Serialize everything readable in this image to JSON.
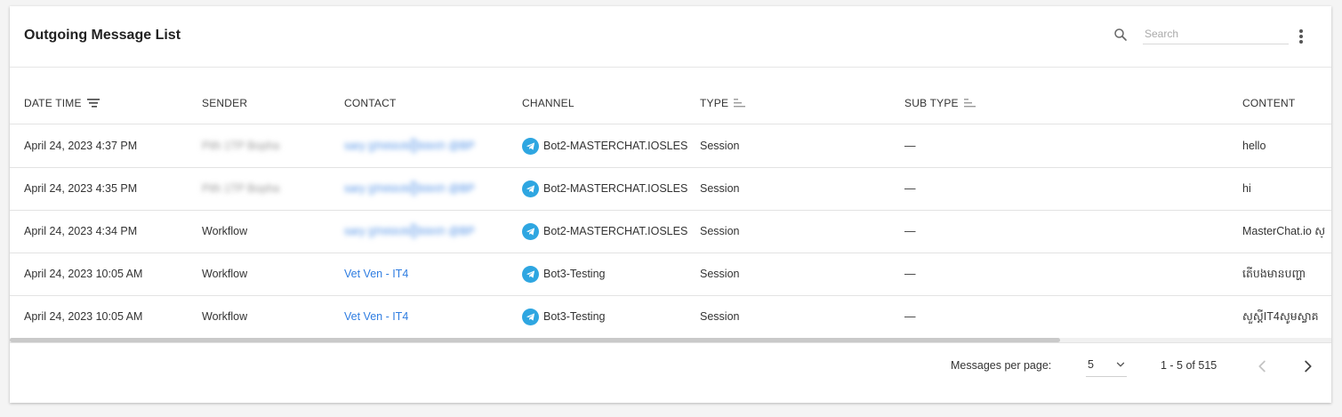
{
  "header": {
    "title": "Outgoing Message List",
    "search_placeholder": "Search"
  },
  "columns": [
    {
      "label": "DATE TIME",
      "icon": "sort-icon"
    },
    {
      "label": "SENDER"
    },
    {
      "label": "CONTACT"
    },
    {
      "label": "CHANNEL"
    },
    {
      "label": "TYPE",
      "icon": "sort-icon"
    },
    {
      "label": "SUB TYPE",
      "icon": "sort-icon"
    },
    {
      "label": "CONTENT"
    }
  ],
  "rows": [
    {
      "datetime": "April 24, 2023 4:37 PM",
      "sender": "Pith 1TP Bopha",
      "contact": "sary ព្រាមសេមឿងមេខា @BP",
      "channel": "Bot2-MASTERCHAT.IOSLES",
      "type": "Session",
      "subtype": "—",
      "content": "hello"
    },
    {
      "datetime": "April 24, 2023 4:35 PM",
      "sender": "Pith 1TP Bopha",
      "contact": "sary ព្រាមសេមឿងមេខា @BP",
      "channel": "Bot2-MASTERCHAT.IOSLES",
      "type": "Session",
      "subtype": "—",
      "content": "hi"
    },
    {
      "datetime": "April 24, 2023 4:34 PM",
      "sender": "Workflow",
      "contact": "sary ព្រាមសេមឿងមេខា @BP",
      "channel": "Bot2-MASTERCHAT.IOSLES",
      "type": "Session",
      "subtype": "—",
      "content": "MasterChat.io ស្"
    },
    {
      "datetime": "April 24, 2023 10:05 AM",
      "sender": "Workflow",
      "contact": "Vet Ven - IT4",
      "channel": "Bot3-Testing",
      "type": "Session",
      "subtype": "—",
      "content": "តើបងមានបញ្ហា"
    },
    {
      "datetime": "April 24, 2023 10:05 AM",
      "sender": "Workflow",
      "contact": "Vet Ven - IT4",
      "channel": "Bot3-Testing",
      "type": "Session",
      "subtype": "—",
      "content": "សួស្តីIT4សូមស្វាគ"
    }
  ],
  "footer": {
    "per_page_label": "Messages per page:",
    "per_page_value": "5",
    "range": "1 - 5 of 515"
  },
  "colors": {
    "link": "#2f7de1",
    "telegram": "#2ea6e1"
  }
}
